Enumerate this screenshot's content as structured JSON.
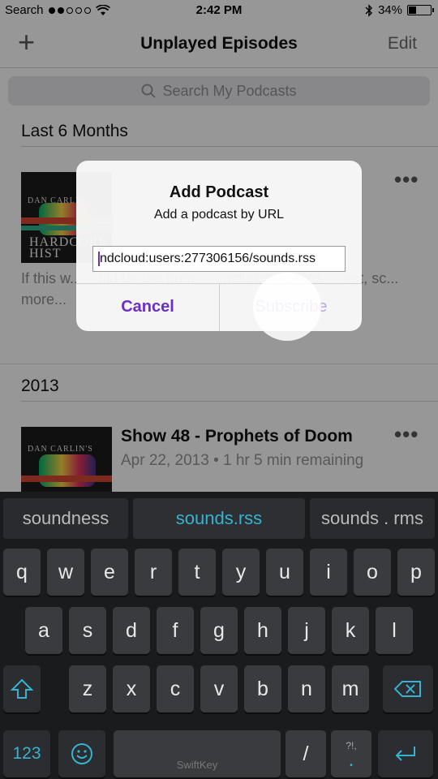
{
  "status_bar": {
    "carrier": "Search",
    "signal_dots_filled": 2,
    "signal_dots_total": 5,
    "time": "2:42 PM",
    "battery": "34%",
    "battery_level": 0.34
  },
  "nav": {
    "add_icon": "plus-icon",
    "title": "Unplayed Episodes",
    "edit_label": "Edit"
  },
  "search": {
    "placeholder": "Search My Podcasts"
  },
  "sections": [
    {
      "header": "Last 6 Months",
      "episode": {
        "artwork_top": "DAN CARLIN'S",
        "artwork_bottom": "HARDCORE HIST",
        "description": "If this w... ...uld be too num... ...ncludes Xerxes, ...eat, sc... more...",
        "more_icon": "ellipsis-icon"
      }
    },
    {
      "header": "2013",
      "episode": {
        "artwork_top": "DAN CARLIN'S",
        "title": "Show 48 - Prophets of Doom",
        "meta": "Apr 22, 2013 • 1 hr 5 min remaining",
        "more_icon": "ellipsis-icon"
      }
    }
  ],
  "dialog": {
    "title": "Add Podcast",
    "message": "Add a podcast by URL",
    "url_value": "ndcloud:users:277306156/sounds.rss",
    "cancel_label": "Cancel",
    "subscribe_label": "Subscribe"
  },
  "keyboard": {
    "suggestions": [
      "soundness",
      "sounds.rss",
      "sounds . rms"
    ],
    "row1": [
      "q",
      "w",
      "e",
      "r",
      "t",
      "y",
      "u",
      "i",
      "o",
      "p"
    ],
    "row2": [
      "a",
      "s",
      "d",
      "f",
      "g",
      "h",
      "j",
      "k",
      "l"
    ],
    "row3": [
      "z",
      "x",
      "c",
      "v",
      "b",
      "n",
      "m"
    ],
    "numbers_label": "123",
    "emoji_icon": "smiley-icon",
    "space_brand": "SwiftKey",
    "slash_label": "/",
    "period_label": ".",
    "period_alt": "?!,",
    "shift_icon": "shift-icon",
    "backspace_icon": "backspace-icon",
    "return_icon": "return-icon",
    "accent_color": "#35b3d0"
  },
  "colors": {
    "tint": "#6b2fc8"
  }
}
